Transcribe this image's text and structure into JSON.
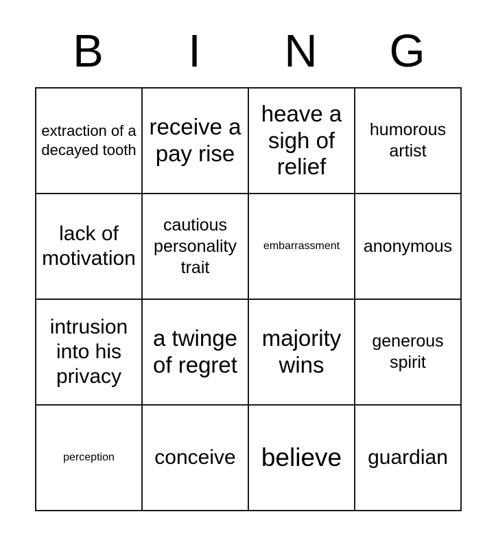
{
  "card": {
    "header_letters": [
      "B",
      "I",
      "N",
      "G"
    ],
    "columns": 4,
    "rows": 4,
    "border_color": "#1a1a1a",
    "cell_background": "#ffffff",
    "text_color": "#000000",
    "cells": [
      [
        {
          "text": "extraction of a decayed tooth",
          "size": "fs-sm"
        },
        {
          "text": "receive a pay rise",
          "size": "fs-xl"
        },
        {
          "text": "heave a sigh of relief",
          "size": "fs-xl"
        },
        {
          "text": "humorous artist",
          "size": "fs-md"
        }
      ],
      [
        {
          "text": "lack of motivation",
          "size": "fs-lg"
        },
        {
          "text": "cautious personality trait",
          "size": "fs-md"
        },
        {
          "text": "embarrassment",
          "size": "fs-xs"
        },
        {
          "text": "anonymous",
          "size": "fs-md"
        }
      ],
      [
        {
          "text": "intrusion into his privacy",
          "size": "fs-lg"
        },
        {
          "text": "a twinge of regret",
          "size": "fs-xl"
        },
        {
          "text": "majority wins",
          "size": "fs-xl"
        },
        {
          "text": "generous spirit",
          "size": "fs-md"
        }
      ],
      [
        {
          "text": "perception",
          "size": "fs-xs"
        },
        {
          "text": "conceive",
          "size": "fs-lg"
        },
        {
          "text": "believe",
          "size": "fs-xxl"
        },
        {
          "text": "guardian",
          "size": "fs-lg"
        }
      ]
    ]
  }
}
